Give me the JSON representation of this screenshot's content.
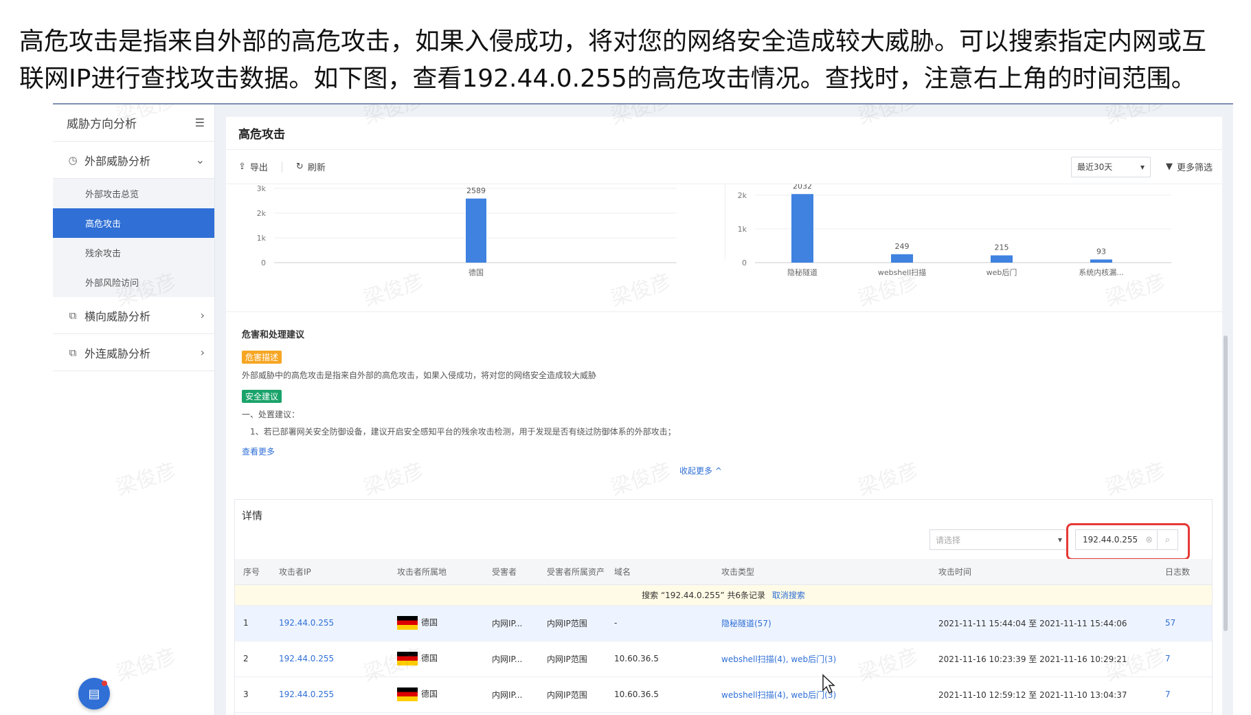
{
  "caption": {
    "line1": "高危攻击是指来自外部的高危攻击，如果入侵成功，将对您的网络安全造成较大威胁。可以搜索指定内网或互",
    "line2": "联网IP进行查找攻击数据。如下图，查看192.44.0.255的高危攻击情况。查找时，注意右上角的时间范围。"
  },
  "sidebar": {
    "header": "威胁方向分析",
    "groups": [
      {
        "label": "外部威胁分析",
        "icon": "clock-icon",
        "expanded": true
      },
      {
        "label": "横向威胁分析",
        "icon": "lateral-icon",
        "expanded": false
      },
      {
        "label": "外连威胁分析",
        "icon": "outbound-icon",
        "expanded": false
      }
    ],
    "subitems": [
      "外部攻击总览",
      "高危攻击",
      "残余攻击",
      "外部风险访问"
    ]
  },
  "main": {
    "title": "高危攻击",
    "toolbar": {
      "export": "导出",
      "refresh": "刷新",
      "time_range": "最近30天",
      "more_filter": "更多筛选"
    }
  },
  "chart_data": [
    {
      "type": "bar",
      "categories": [
        "德国"
      ],
      "values": [
        2589
      ],
      "ylim": [
        0,
        3000
      ],
      "yticks": [
        "0",
        "1k",
        "2k",
        "3k"
      ],
      "color": "#3f82e0"
    },
    {
      "type": "bar",
      "categories": [
        "隐秘隧道",
        "webshell扫描",
        "web后门",
        "系统内核漏..."
      ],
      "values": [
        2032,
        249,
        215,
        93
      ],
      "ylim": [
        0,
        2200
      ],
      "yticks": [
        "0",
        "1k",
        "2k"
      ],
      "color": "#3f82e0"
    }
  ],
  "advice": {
    "title": "危害和处理建议",
    "harm_tag": "危害描述",
    "harm_text": "外部威胁中的高危攻击是指来自外部的高危攻击，如果入侵成功，将对您的网络安全造成较大威胁",
    "suggest_tag": "安全建议",
    "suggest_heading": "一、处置建议：",
    "suggest_item": "1、若已部署网关安全防御设备，建议开启安全感知平台的残余攻击检测，用于发现是否有绕过防御体系的外部攻击；",
    "see_more": "查看更多",
    "collapse": "收起更多 ^"
  },
  "details": {
    "title": "详情",
    "select_placeholder": "请选择",
    "search_value": "192.44.0.255",
    "columns": [
      "序号",
      "攻击者IP",
      "攻击者所属地",
      "受害者",
      "受害者所属资产",
      "域名",
      "攻击类型",
      "攻击时间",
      "日志数"
    ],
    "notice": "搜索 “192.44.0.255” 共6条记录",
    "cancel_search": "取消搜索",
    "rows": [
      {
        "no": "1",
        "ip": "192.44.0.255",
        "loc": "德国",
        "victim": "内网IP...",
        "asset": "内网IP范围",
        "domain": "-",
        "type": "隐秘隧道(57)",
        "time": "2021-11-11 15:44:04 至 2021-11-11 15:44:06",
        "count": "57"
      },
      {
        "no": "2",
        "ip": "192.44.0.255",
        "loc": "德国",
        "victim": "内网IP...",
        "asset": "内网IP范围",
        "domain": "10.60.36.5",
        "type": "webshell扫描(4), web后门(3)",
        "time": "2021-11-16 10:23:39 至 2021-11-16 10:29:21",
        "count": "7"
      },
      {
        "no": "3",
        "ip": "192.44.0.255",
        "loc": "德国",
        "victim": "内网IP...",
        "asset": "内网IP范围",
        "domain": "10.60.36.5",
        "type": "webshell扫描(4), web后门(3)",
        "time": "2021-11-10 12:59:12 至 2021-11-10 13:04:37",
        "count": "7"
      }
    ]
  },
  "watermark": "梁俊彦"
}
